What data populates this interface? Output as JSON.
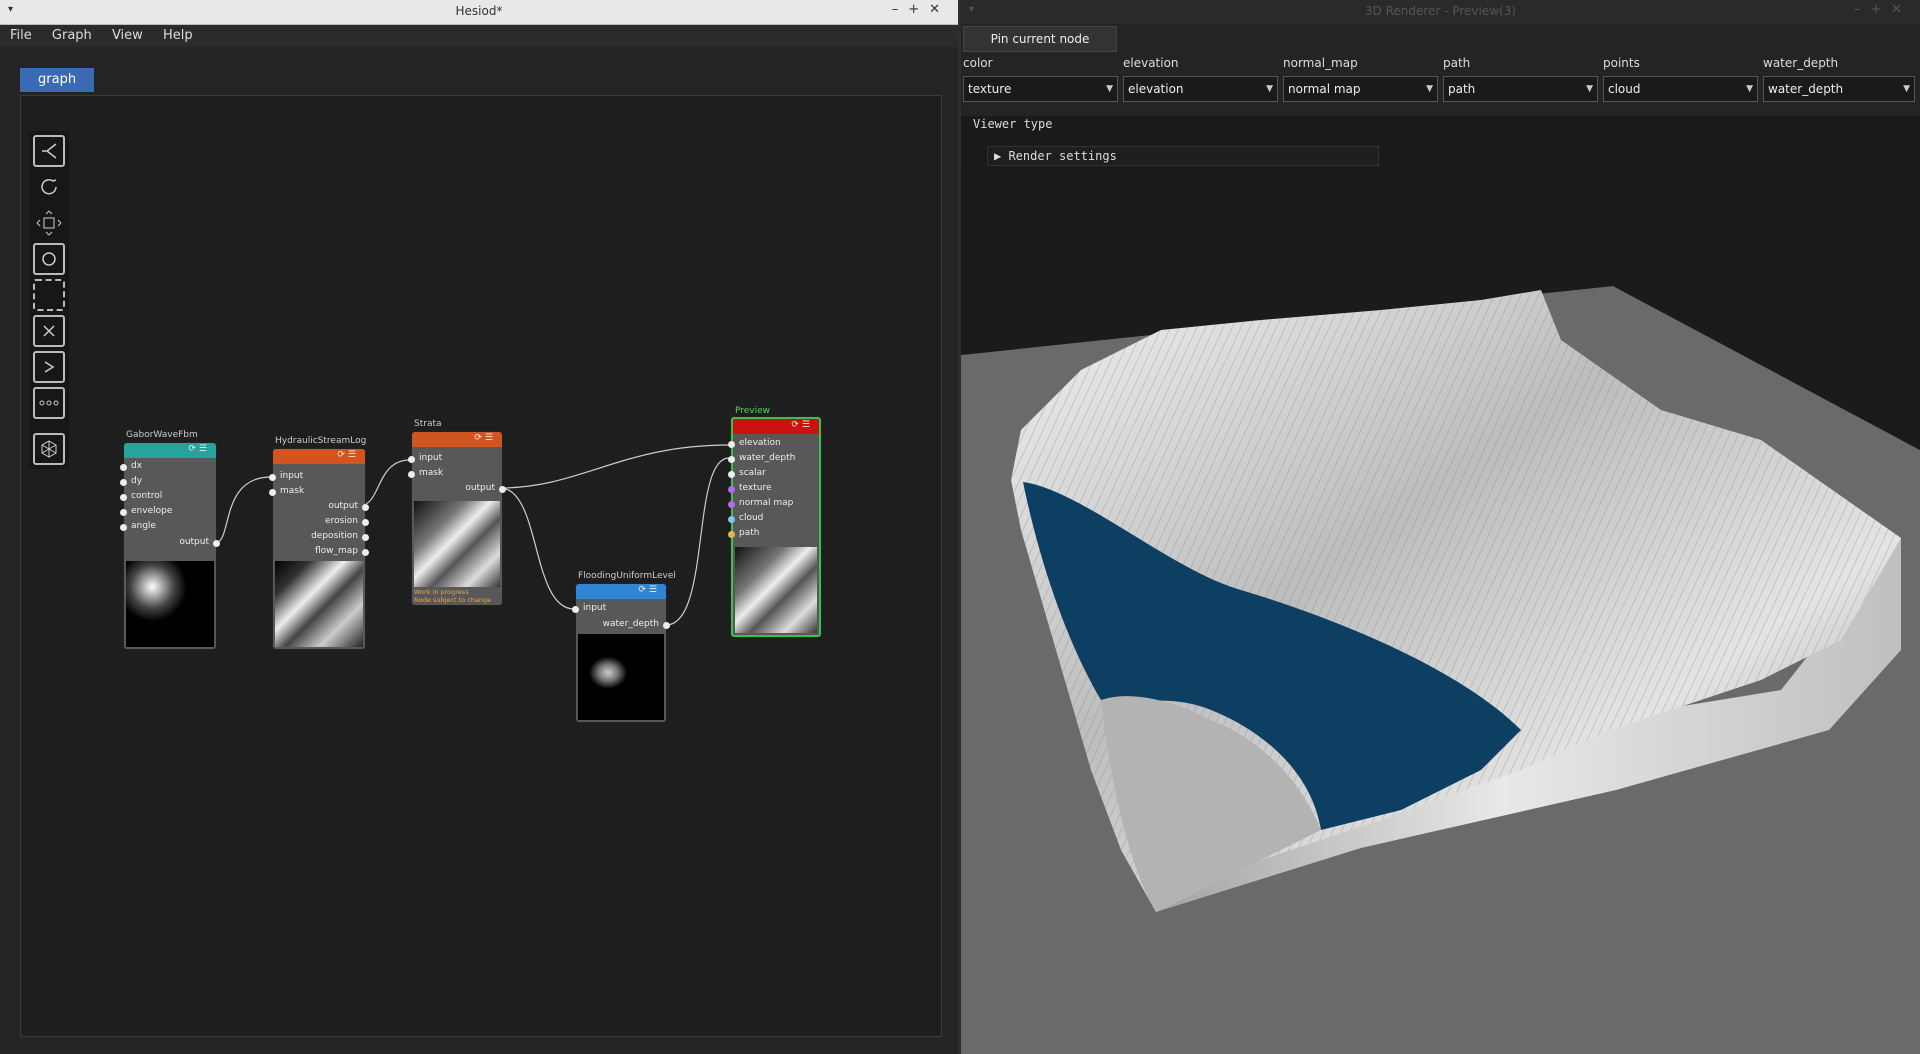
{
  "left_window": {
    "title": "Hesiod*",
    "menu": [
      "File",
      "Graph",
      "View",
      "Help"
    ],
    "tab": "graph"
  },
  "toolbar": [
    "layout-icon",
    "reload-icon",
    "fit-view-icon",
    "circle-icon",
    "select-icon",
    "delete-icon",
    "play-icon",
    "more-icon",
    "viewer-icon"
  ],
  "nodes": {
    "gabor": {
      "title": "GaborWaveFbm",
      "inputs": [
        "dx",
        "dy",
        "control",
        "envelope",
        "angle"
      ],
      "output": "output",
      "color": "#26a39a"
    },
    "hydraulic": {
      "title": "HydraulicStreamLog",
      "inputs": [
        "input",
        "mask"
      ],
      "outputs": [
        "output",
        "erosion",
        "deposition",
        "flow_map"
      ],
      "color": "#d2541f"
    },
    "strata": {
      "title": "Strata",
      "inputs": [
        "input",
        "mask"
      ],
      "output": "output",
      "color": "#d2541f",
      "note": [
        "Work in progress",
        "Node subject to change"
      ]
    },
    "flooding": {
      "title": "FloodingUniformLevel",
      "inputs": [
        "input"
      ],
      "output": "water_depth",
      "color": "#2f86d4"
    },
    "preview": {
      "title": "Preview",
      "inputs": [
        "elevation",
        "water_depth",
        "scalar",
        "texture",
        "normal map",
        "cloud",
        "path"
      ],
      "color": "#cc1111"
    }
  },
  "right_window": {
    "title": "3D Renderer - Preview(3)",
    "pin_button": "Pin current node",
    "fields": [
      {
        "label": "color",
        "value": "texture"
      },
      {
        "label": "elevation",
        "value": "elevation"
      },
      {
        "label": "normal_map",
        "value": "normal map"
      },
      {
        "label": "path",
        "value": "path"
      },
      {
        "label": "points",
        "value": "cloud"
      },
      {
        "label": "water_depth",
        "value": "water_depth"
      }
    ],
    "viewer_type": "Viewer type",
    "render_settings": "Render settings"
  }
}
